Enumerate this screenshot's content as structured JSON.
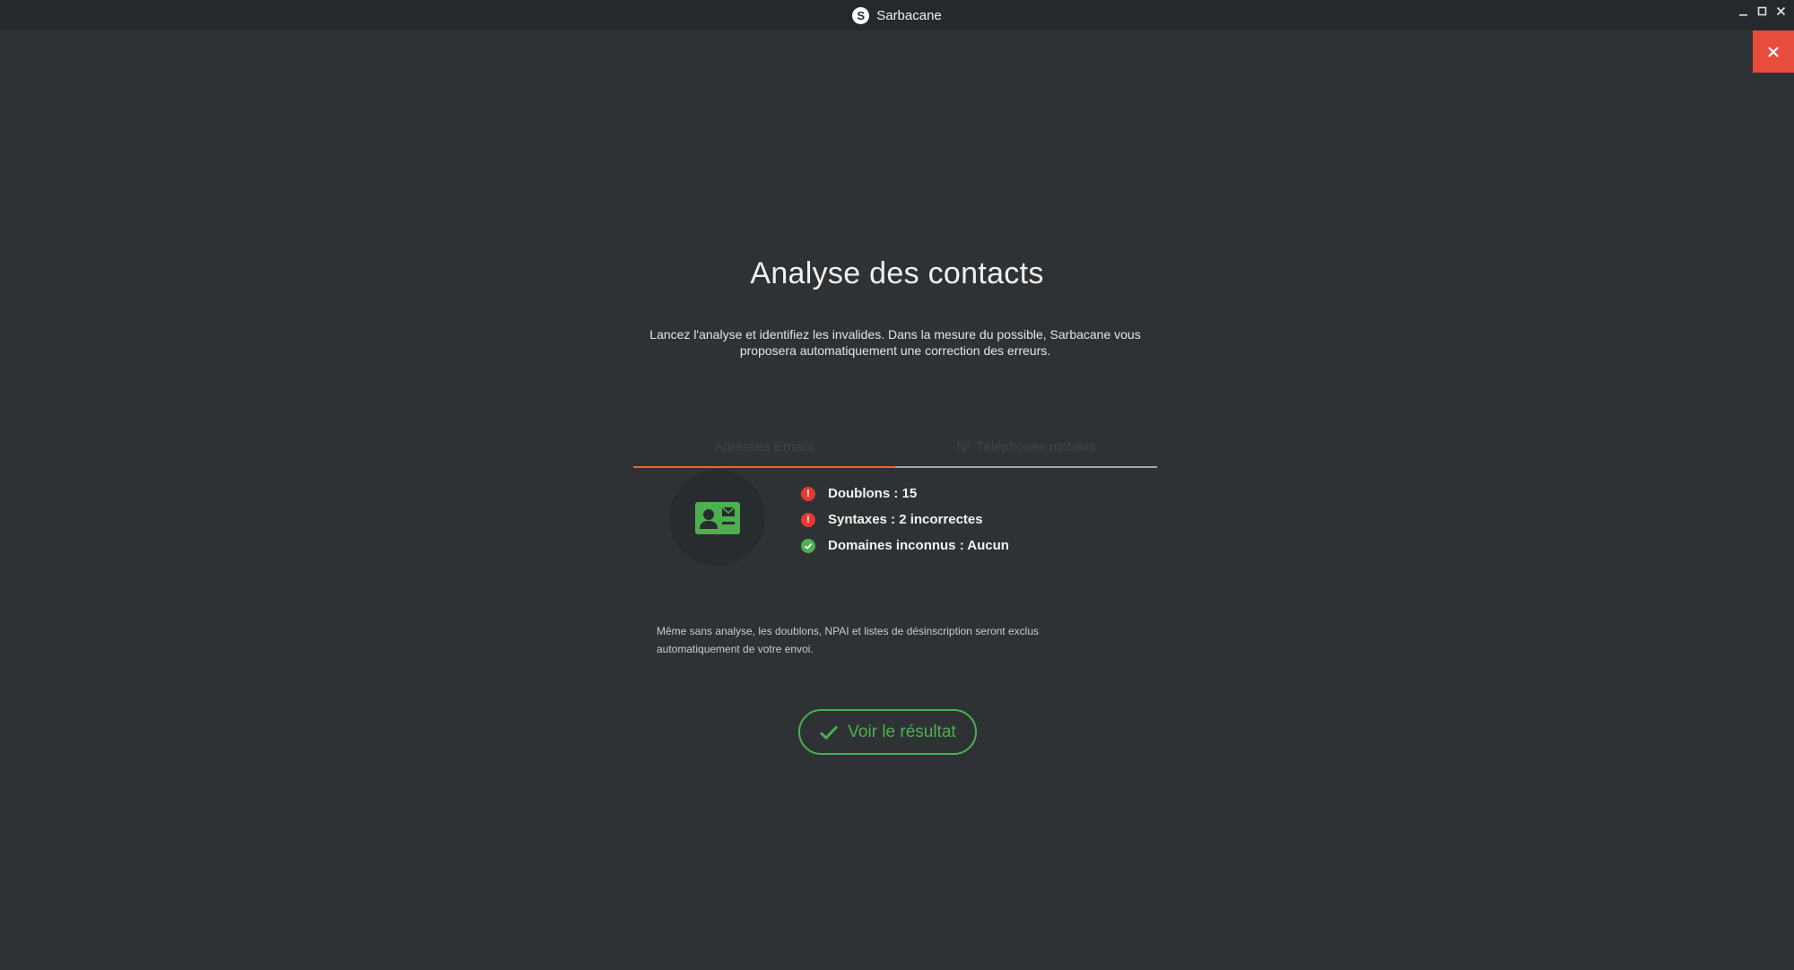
{
  "window": {
    "app_title": "Sarbacane",
    "logo_letter": "S"
  },
  "colors": {
    "background": "#2f3235",
    "titlebar": "#26292b",
    "close_panel": "#e74c3c",
    "active_tab": "#e8643a",
    "success": "#4caf50",
    "error": "#e53935"
  },
  "main": {
    "title": "Analyse des contacts",
    "description": "Lancez l'analyse et identifiez les invalides. Dans la mesure du possible, Sarbacane vous proposera automatiquement une correction des erreurs.",
    "tabs": [
      {
        "label": "Adresses Emails",
        "active": true
      },
      {
        "label": "N° Téléphones mobiles",
        "active": false
      }
    ],
    "avatar_icon": "contact-card-icon",
    "checks": [
      {
        "status": "error",
        "icon": "alert-icon",
        "text": "Doublons : 15"
      },
      {
        "status": "error",
        "icon": "alert-icon",
        "text": "Syntaxes : 2 incorrectes"
      },
      {
        "status": "ok",
        "icon": "check-circle-icon",
        "text": "Domaines inconnus : Aucun"
      }
    ],
    "note": "Même sans analyse, les doublons, NPAI et listes de désinscription seront exclus automatiquement de votre envoi.",
    "result_button_label": "Voir le résultat"
  }
}
